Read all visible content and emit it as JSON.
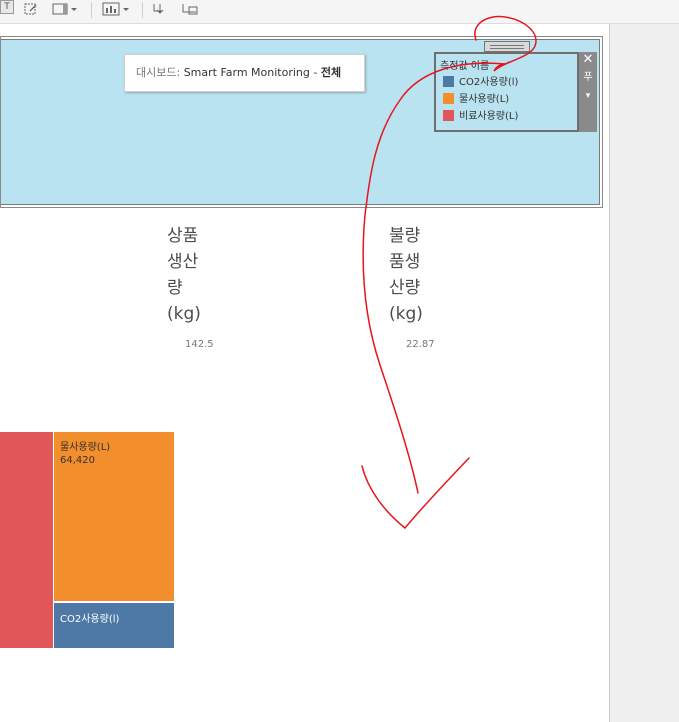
{
  "toolbar": {
    "buttons": [
      "text-tool",
      "edit-tool",
      "frame-tool",
      "chart-tool",
      "download-tool",
      "present-tool"
    ]
  },
  "header": {
    "title_prefix": "대시보드: ",
    "title_name": "Smart Farm Monitoring",
    "title_sep": " - ",
    "title_filter": "전체"
  },
  "legend": {
    "title": "측정값 이름",
    "items": [
      {
        "label": "CO2사용량(l)",
        "color": "#4e79a7"
      },
      {
        "label": "물사용량(L)",
        "color": "#f28e2b"
      },
      {
        "label": "비료사용량(L)",
        "color": "#e15759"
      }
    ],
    "close_glyph": "✕",
    "pin_glyph": "푸",
    "menu_glyph": "▾"
  },
  "kpis": [
    {
      "label_lines": [
        "상품",
        "생산",
        "량",
        "(kg)"
      ],
      "value": "142.5"
    },
    {
      "label_lines": [
        "불량",
        "품생",
        "산량",
        "(kg)"
      ],
      "value": "22.87"
    }
  ],
  "treemap": {
    "cells": [
      {
        "name": "비료사용량(L)",
        "value": null,
        "color": "#e15759",
        "label_shown": false
      },
      {
        "name": "물사용량(L)",
        "value": "64,420",
        "color": "#f28e2b",
        "label_shown": true
      },
      {
        "name": "CO2사용량(l)",
        "value": null,
        "color": "#4e79a7",
        "label_shown": true
      }
    ]
  },
  "colors": {
    "header_bg": "#b9e3f0",
    "annotation": "#e8141c"
  }
}
